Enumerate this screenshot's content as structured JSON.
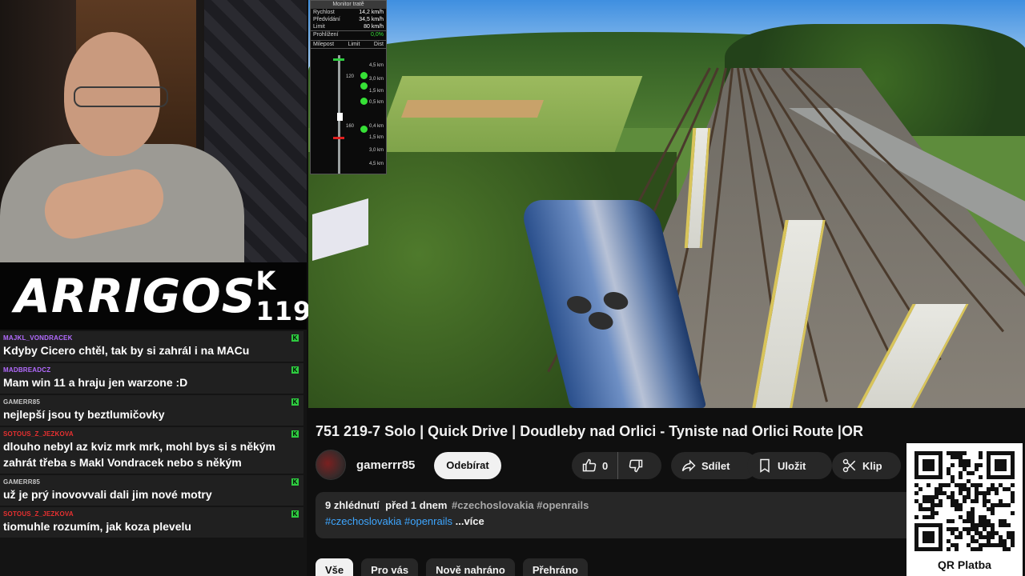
{
  "stream": {
    "logo_text": "ARRIGOS",
    "tag_text": "K 119"
  },
  "chat": {
    "messages": [
      {
        "user": "MAJKL_VONDRACEK",
        "user_color": "#b36bff",
        "text": "Kdyby Cicero chtěl, tak by si zahrál i na MACu"
      },
      {
        "user": "MADBREADCZ",
        "user_color": "#b36bff",
        "text": "Mam win 11 a hraju jen warzone :D"
      },
      {
        "user": "GAMERR85",
        "user_color": "#c8c8c8",
        "text": "nejlepší jsou ty beztlumičovky"
      },
      {
        "user": "SOTOUS_Z_JEZKOVA",
        "user_color": "#e83030",
        "text": "dlouho nebyl az kviz mrk mrk, mohl bys si s někým zahrát třeba s Makl Vondracek nebo s někým"
      },
      {
        "user": "GAMERR85",
        "user_color": "#c8c8c8",
        "text": "už je prý inovovvali dali jim nové motry"
      },
      {
        "user": "SOTOUS_Z_JEZKOVA",
        "user_color": "#e83030",
        "text": "tiomuhle rozumím, jak koza plevelu"
      }
    ]
  },
  "track_monitor": {
    "title": "Monitor tratě",
    "speed_label": "Rychlost",
    "speed_value": "14,2 km/h",
    "projected_label": "Předvídání",
    "projected_value": "34,5 km/h",
    "limit_label": "Limit",
    "limit_value": "80 km/h",
    "gradient_label": "Prohlížení",
    "gradient_value": "0,0%",
    "col_milepost": "Milepost",
    "col_limit": "Limit",
    "col_dist": "Dist",
    "ahead_limit": "120",
    "behind_limit": "160",
    "ahead_dists": [
      "4,5 km",
      "3,0 km",
      "1,5 km",
      "0,5 km"
    ],
    "behind_dists": [
      "0,4 km",
      "1,5 km",
      "3,0 km",
      "4,5 km"
    ]
  },
  "video": {
    "title": "751 219-7 Solo | Quick Drive | Doudleby nad Orlici - Tyniste nad Orlici Route |OR",
    "channel": "gamerrr85",
    "subscribe_label": "Odebírat",
    "like_count": "0",
    "share_label": "Sdílet",
    "save_label": "Uložit",
    "clip_label": "Klip",
    "views": "9 zhlédnutí",
    "uploaded": "před 1 dnem",
    "header_tags": "#czechoslovakia #openrails",
    "desc_tags": "#czechoslovakia #openrails",
    "more_label": "...více"
  },
  "chips": [
    "Vše",
    "Pro vás",
    "Nově nahráno",
    "Přehráno"
  ],
  "qr": {
    "caption": "QR Platba"
  },
  "colors": {
    "background": "#0f0f0f",
    "pill": "#272727",
    "link": "#3ea6ff",
    "signal_green": "#36e036"
  }
}
